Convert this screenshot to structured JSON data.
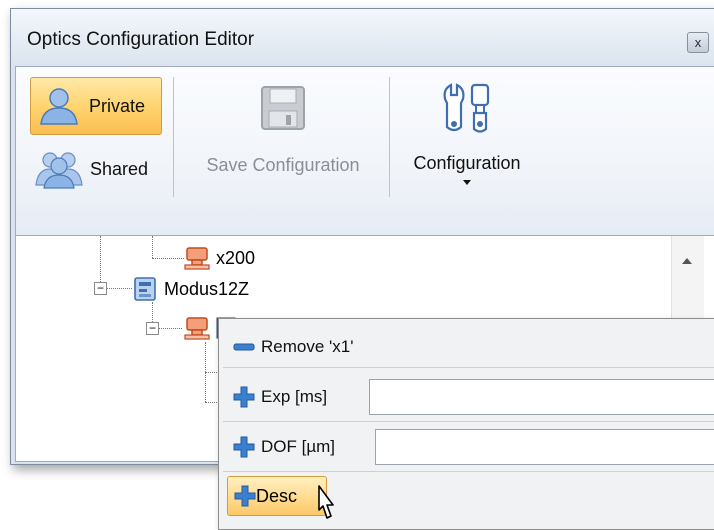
{
  "window": {
    "title": "Optics Configuration Editor",
    "close_glyph": "x"
  },
  "ribbon": {
    "private_label": "Private",
    "shared_label": "Shared",
    "save_label": "Save Configuration",
    "configuration_label": "Configuration"
  },
  "tree": {
    "nodes": [
      {
        "label": "x200",
        "icon": "objective-icon"
      },
      {
        "label": "Modus12Z",
        "icon": "microscope-module-icon",
        "expanded": true
      },
      {
        "label": "",
        "icon": "objective-icon",
        "expanded": true
      }
    ],
    "expander_glyph": "−"
  },
  "context_menu": {
    "items": [
      {
        "label": "Remove 'x1'",
        "icon": "minus-icon"
      },
      {
        "label": "Exp [ms]",
        "icon": "plus-icon",
        "value": ""
      },
      {
        "label": "DOF [µm]",
        "icon": "plus-icon",
        "value": ""
      },
      {
        "label": "Desc",
        "icon": "plus-icon",
        "highlighted": true
      }
    ]
  },
  "colors": {
    "highlight": "#ffd470",
    "ribbon_bg": "#f2f5fa",
    "plus_icon": "#3a7fd0",
    "objective_icon": "#e0603a"
  }
}
